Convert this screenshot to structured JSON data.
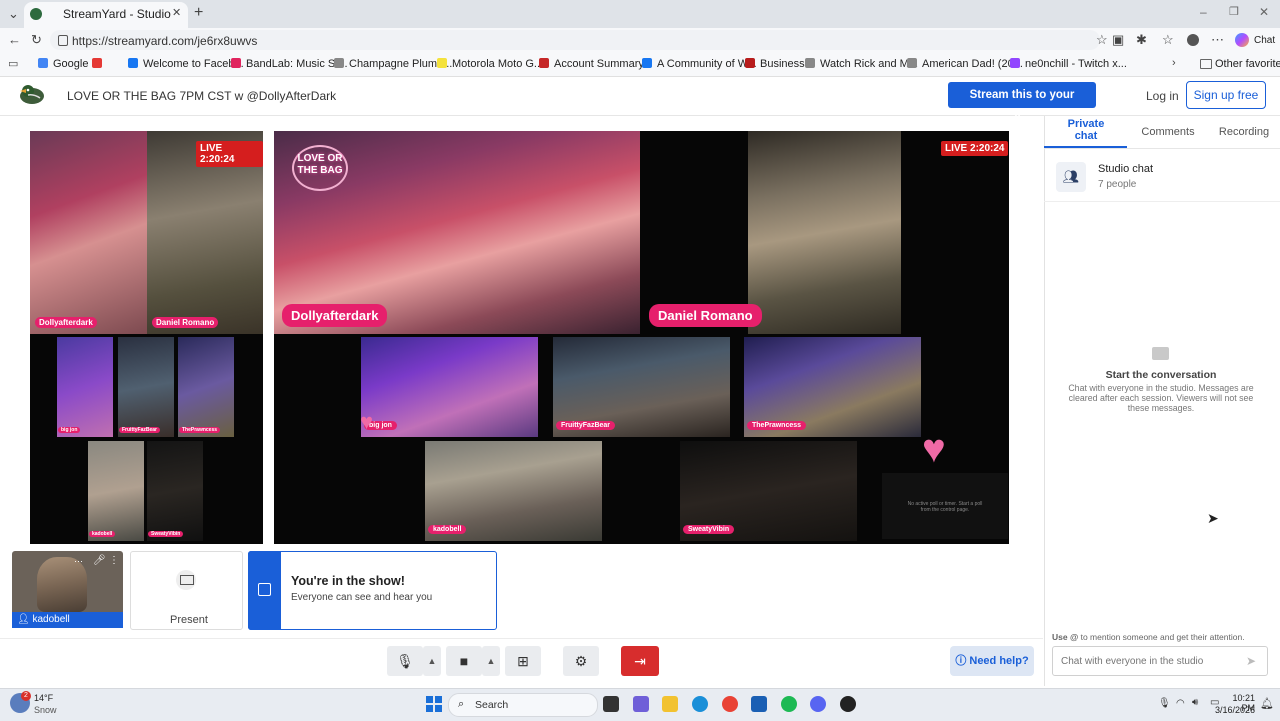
{
  "browser": {
    "tab_title": "StreamYard - Studio",
    "url": "https://streamyard.com/je6rx8uwvs",
    "chat_label": "Chat",
    "new_tab": "+",
    "close_tab": "✕",
    "favorites": [
      {
        "label": "Google",
        "color": "#4285f4"
      },
      {
        "label": "",
        "color": "#e53935"
      },
      {
        "label": "Welcome to Faceb...",
        "color": "#1877f2"
      },
      {
        "label": "BandLab: Music St...",
        "color": "#e0245e"
      },
      {
        "label": "Champagne Plumb...",
        "color": "#888888"
      },
      {
        "label": "Motorola Moto G...",
        "color": "#f4e23c"
      },
      {
        "label": "Account Summary...",
        "color": "#c62828"
      },
      {
        "label": "A Community of W...",
        "color": "#1877f2"
      },
      {
        "label": "Business",
        "color": "#b71c1c"
      },
      {
        "label": "Watch Rick and M...",
        "color": "#888888"
      },
      {
        "label": "American Dad! (20...",
        "color": "#888888"
      },
      {
        "label": "ne0nchill - Twitch x...",
        "color": "#9146ff"
      }
    ],
    "other_favorites": "Other favorites"
  },
  "header": {
    "broadcast_title": "LOVE OR THE BAG 7PM CST w @DollyAfterDark",
    "stream_button": "Stream this to your audience",
    "login": "Log in",
    "signup": "Sign up free"
  },
  "stage": {
    "live_badge": "LIVE 2:20:24",
    "logo_text": "LOVE OR THE BAG",
    "main_names": [
      "Dollyafterdark",
      "Daniel Romano"
    ],
    "guest_names_row1": [
      "big jon",
      "FruittyFazBear",
      "ThePrawncess"
    ],
    "guest_names_row2": [
      "kadobell",
      "SweatyVibin"
    ],
    "poll_note": "No active poll or timer. Start a poll from the control page."
  },
  "bottom": {
    "self_name": "kadobell",
    "present": "Present",
    "show_title": "You're in the show!",
    "show_subtitle": "Everyone can see and hear you"
  },
  "controls": {
    "help": "Need help?"
  },
  "panel": {
    "tabs": [
      "Private chat",
      "Comments",
      "Recording"
    ],
    "studio_chat_title": "Studio chat",
    "studio_chat_count": "7 people",
    "conv_title": "Start the conversation",
    "conv_text": "Chat with everyone in the studio. Messages are cleared after each session. Viewers will not see these messages.",
    "mention_prefix": "Use @",
    "mention_hint": " to mention someone and get their attention.",
    "chat_placeholder": "Chat with everyone in the studio"
  },
  "taskbar": {
    "weather_temp": "14°F",
    "weather_desc": "Snow",
    "weather_badge": "2",
    "search": "Search",
    "time": "10:21 PM",
    "date": "3/16/2026"
  }
}
